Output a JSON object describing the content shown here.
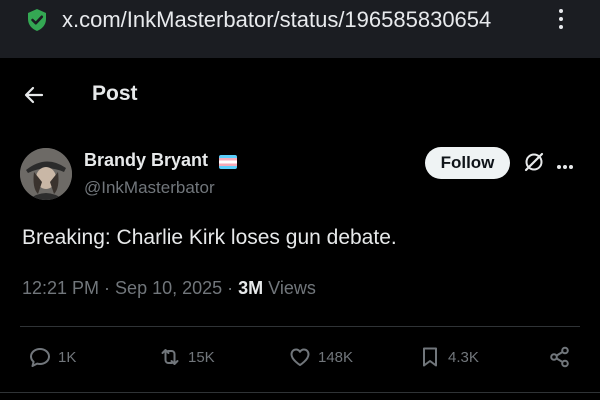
{
  "browser": {
    "url": "x.com/InkMasterbator/status/196585830654"
  },
  "header": {
    "title": "Post"
  },
  "post": {
    "author_name": "Brandy Bryant",
    "author_handle": "@InkMasterbator",
    "follow_label": "Follow",
    "text": "Breaking: Charlie Kirk loses gun debate.",
    "time": "12:21 PM",
    "separator": " · ",
    "date": "Sep 10, 2025",
    "views_count": "3M",
    "views_label": " Views"
  },
  "actions": {
    "replies": "1K",
    "reposts": "15K",
    "likes": "148K",
    "bookmarks": "4.3K"
  },
  "colors": {
    "background": "#000000",
    "urlbar": "#1b1d22",
    "shield_green": "#34a853",
    "muted_text": "#71767b",
    "primary_text": "#e7e9ea"
  }
}
